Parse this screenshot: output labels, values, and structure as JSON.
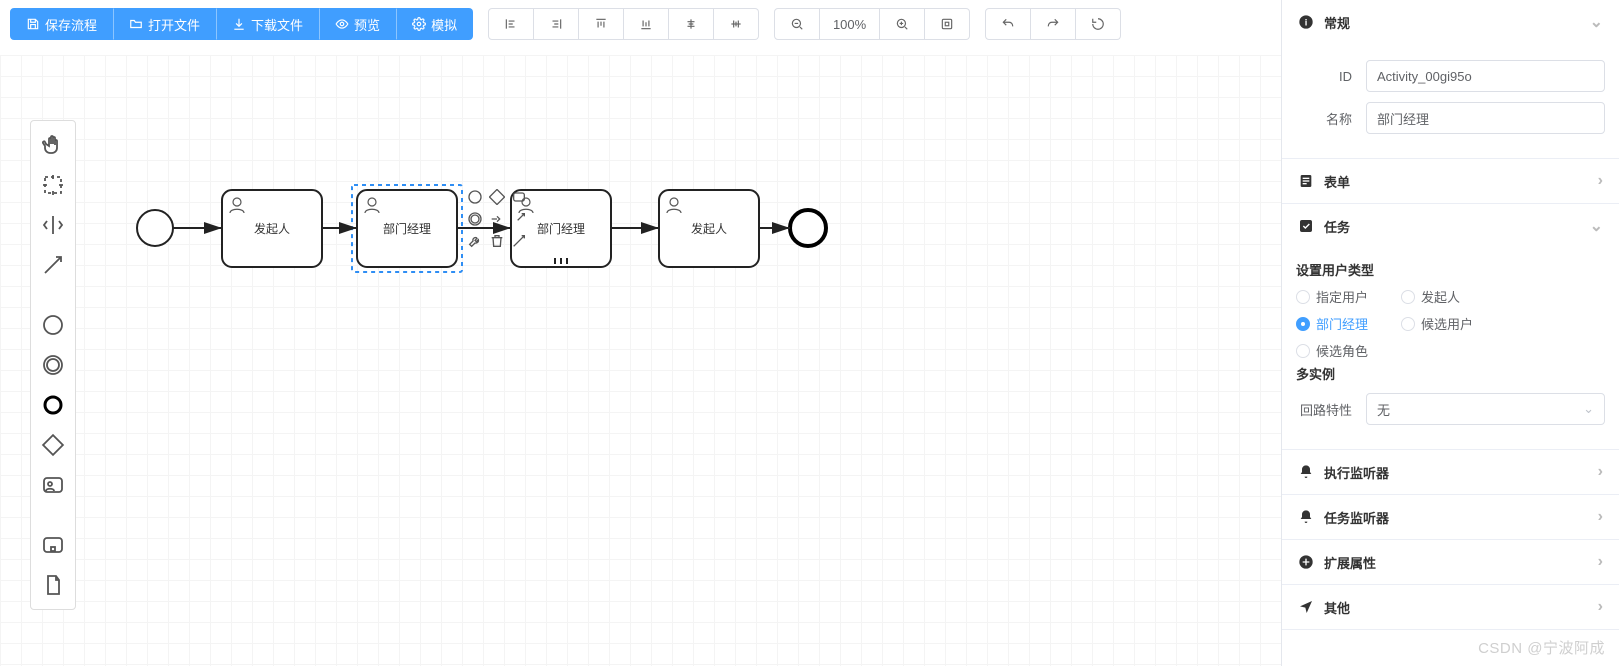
{
  "toolbar": {
    "save": "保存流程",
    "open": "打开文件",
    "download": "下载文件",
    "preview": "预览",
    "simulate": "模拟",
    "zoom_label": "100%"
  },
  "canvas": {
    "start_label": "",
    "task1": "发起人",
    "task2": "部门经理",
    "task3": "部门经理",
    "task4": "发起人",
    "end_label": ""
  },
  "props": {
    "sections": {
      "general": "常规",
      "form": "表单",
      "task": "任务",
      "exec_listener": "执行监听器",
      "task_listener": "任务监听器",
      "extension": "扩展属性",
      "other": "其他"
    },
    "general": {
      "id_label": "ID",
      "id_value": "Activity_00gi95o",
      "name_label": "名称",
      "name_value": "部门经理"
    },
    "task": {
      "user_type_title": "设置用户类型",
      "radios": {
        "assigned": "指定用户",
        "initiator": "发起人",
        "dept_mgr": "部门经理",
        "candidate_user": "候选用户",
        "candidate_role": "候选角色"
      },
      "selected_key": "dept_mgr",
      "multi_instance_title": "多实例",
      "loop_label": "回路特性",
      "loop_value": "无"
    }
  },
  "watermark": "CSDN @宁波阿成"
}
